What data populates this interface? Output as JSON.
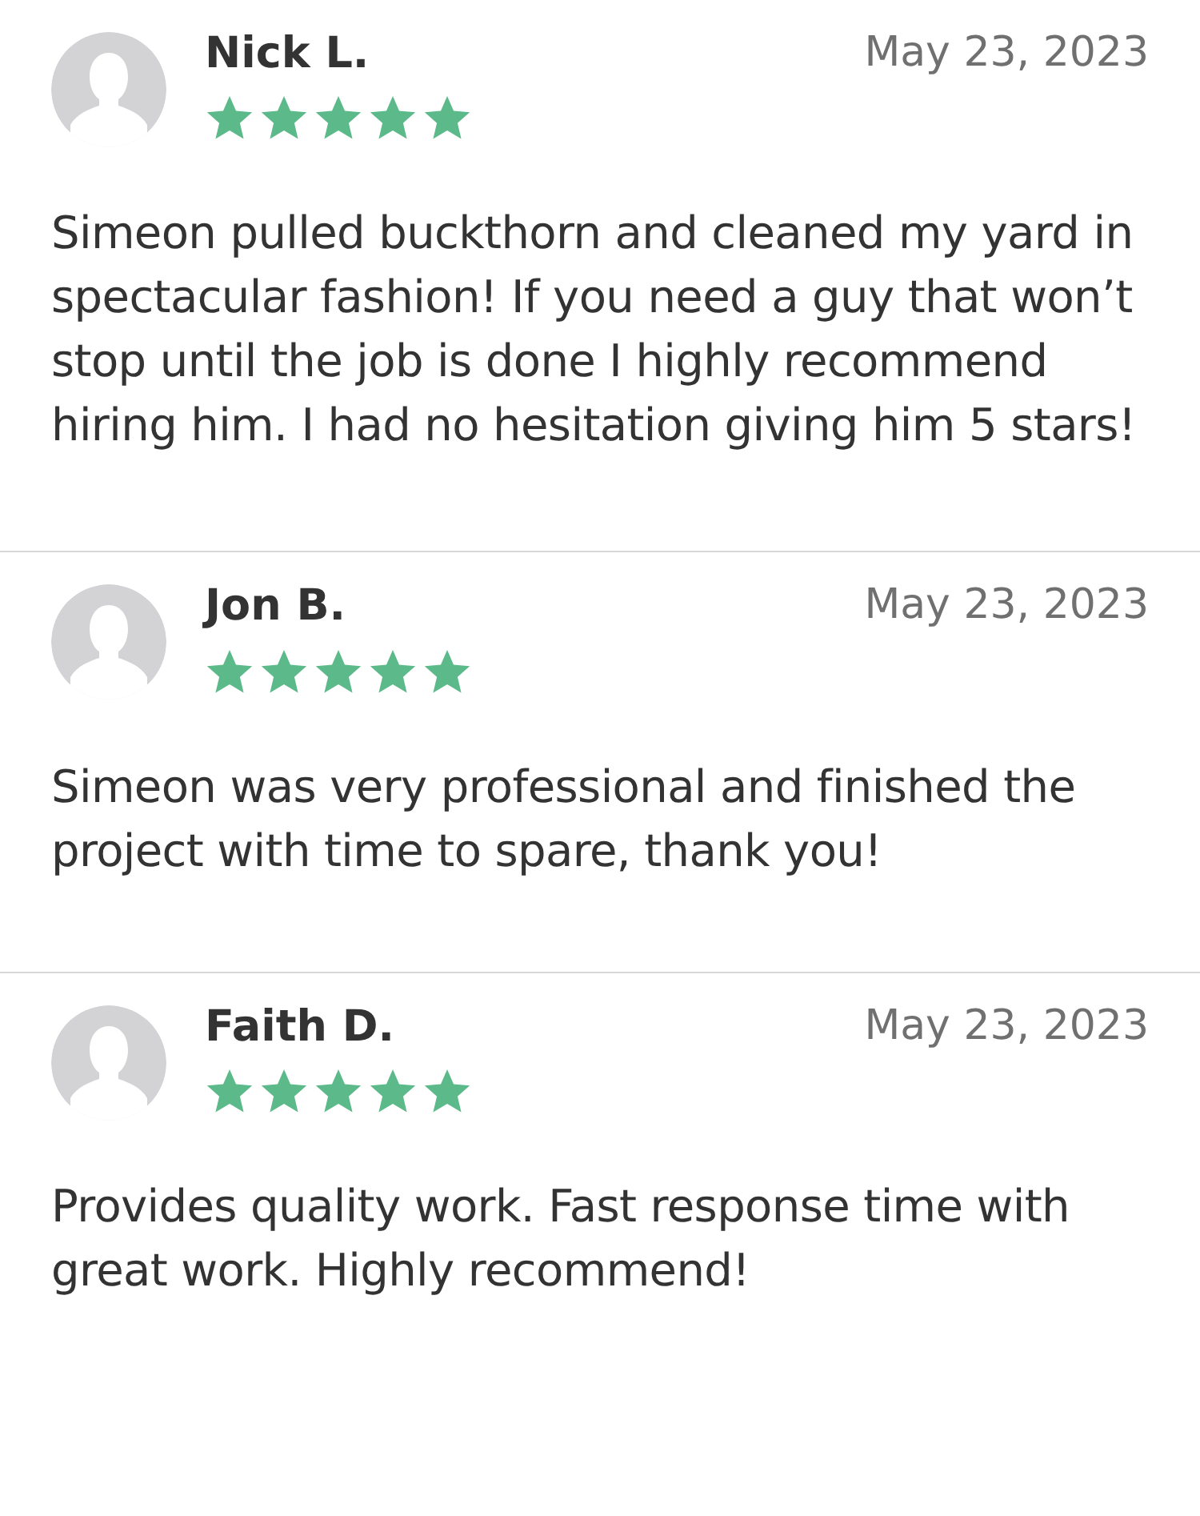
{
  "reviews": [
    {
      "name": "Nick L.",
      "date": "May 23, 2023",
      "stars": 5,
      "text": "Simeon pulled buckthorn and cleaned my yard in spectacular fashion! If you need a guy that won’t stop until the job is done I highly recommend hiring him. I had no hesitation giving him 5 stars!"
    },
    {
      "name": "Jon B.",
      "date": "May 23, 2023",
      "stars": 5,
      "text": "Simeon was very professional and finished the project with time to spare, thank you!"
    },
    {
      "name": "Faith D.",
      "date": "May 23, 2023",
      "stars": 5,
      "text": "Provides quality work. Fast response time with great work. Highly recommend!"
    }
  ]
}
